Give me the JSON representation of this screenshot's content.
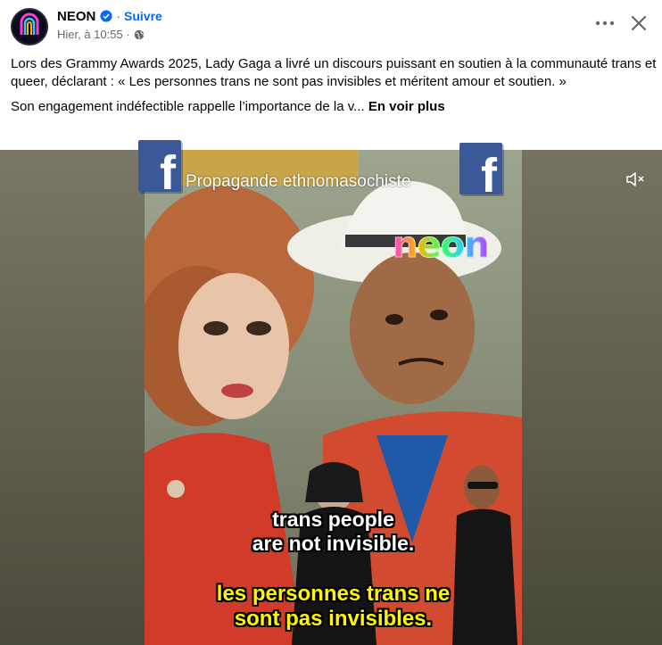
{
  "header": {
    "page_name": "NEON",
    "follow_label": "Suivre",
    "separator": "·",
    "timestamp": "Hier, à 10:55 ·"
  },
  "post": {
    "paragraph_1": "Lors des Grammy Awards 2025, Lady Gaga a livré un discours puissant en soutien à la communauté trans et queer, déclarant : « Les personnes trans ne sont pas invisibles et méritent amour et soutien. »",
    "paragraph_2": "Son engagement indéfectible rappelle l’importance de la v...",
    "see_more": "En voir plus"
  },
  "video": {
    "overlay_title": "Propagande ethnomasochiste",
    "fb_badge_letter": "f",
    "watermark": "neon",
    "subtitle_en_line1": "trans people",
    "subtitle_en_line2": "are not invisible.",
    "subtitle_fr_line1": "les personnes trans ne",
    "subtitle_fr_line2": "sont pas invisibles."
  },
  "icons": {
    "more": "more-options-icon",
    "close": "close-icon",
    "mute": "muted-speaker-icon",
    "verified": "verified-badge-icon",
    "audience": "globe-icon"
  },
  "colors": {
    "link_blue": "#0866ff",
    "secondary_text": "#65676b",
    "fb_badge": "#3b5998",
    "subtitle_fr": "#fff600"
  }
}
